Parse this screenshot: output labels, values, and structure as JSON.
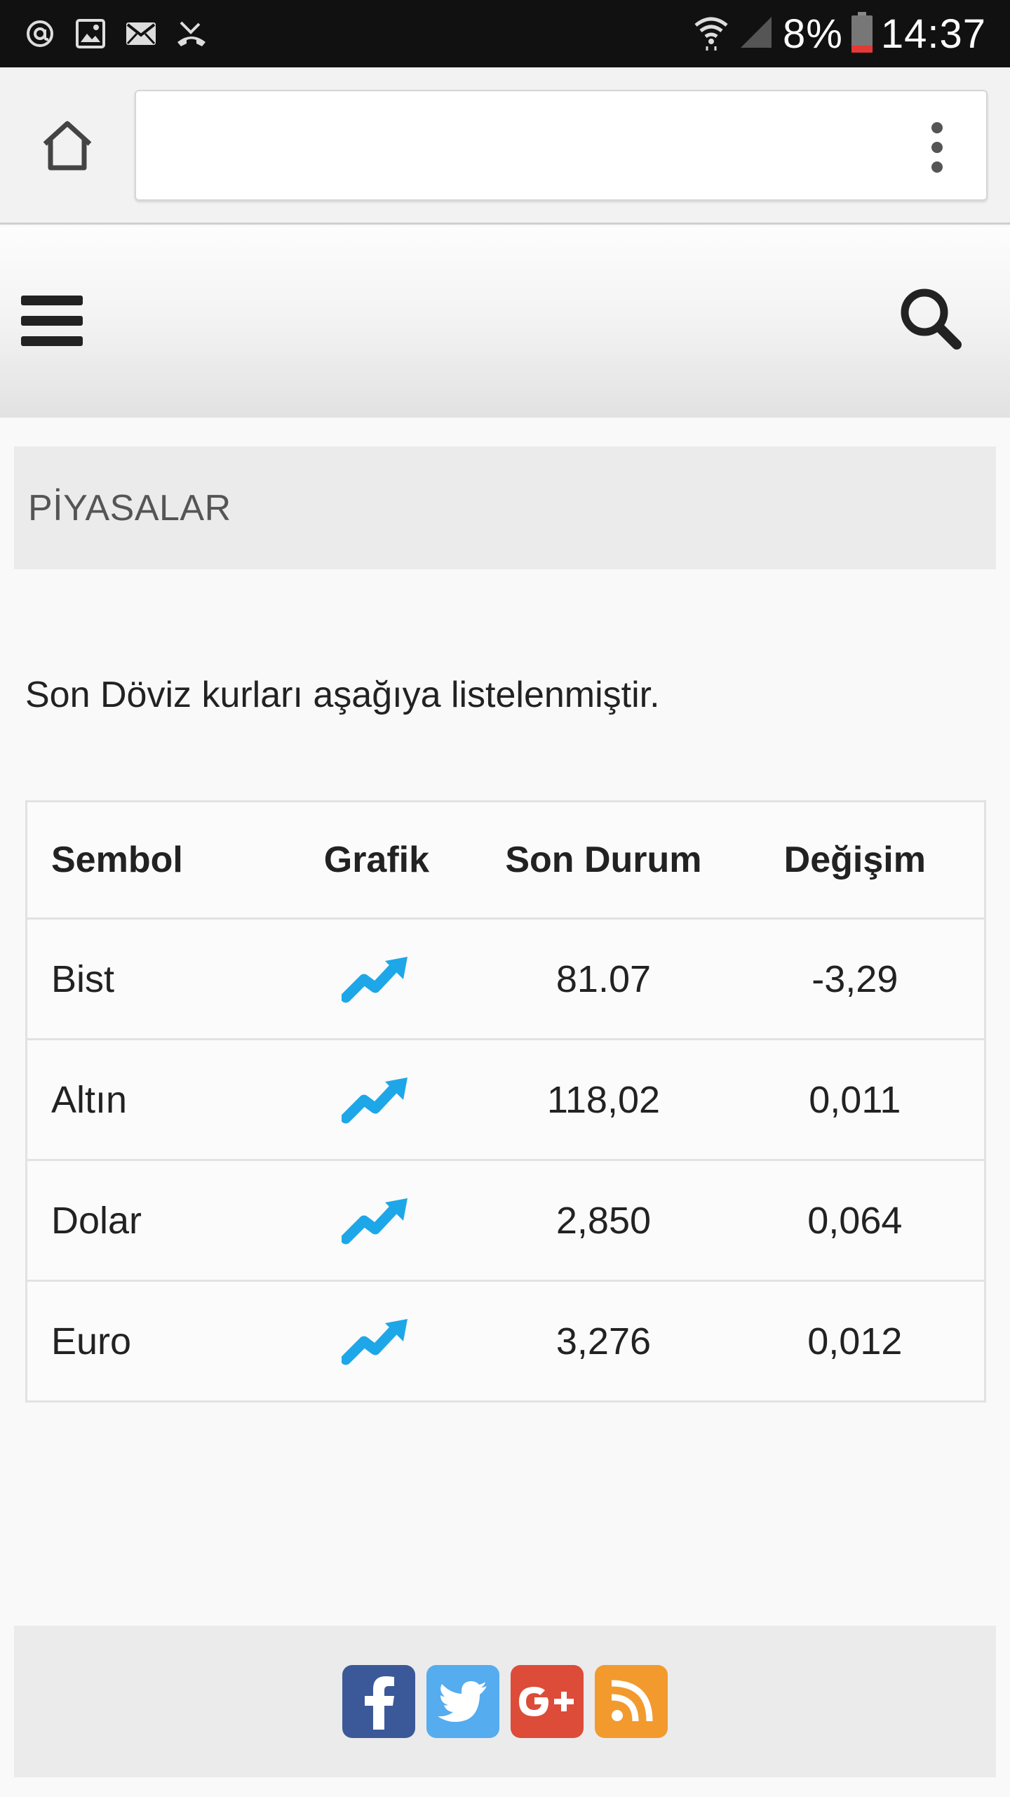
{
  "status_bar": {
    "battery_percent": "8%",
    "time": "14:37",
    "icons": [
      "at-icon",
      "image-icon",
      "mail-icon",
      "missed-call-icon",
      "wifi-icon",
      "signal-icon",
      "battery-icon"
    ]
  },
  "browser": {
    "url": "",
    "icons": [
      "home-icon",
      "more-vert-icon"
    ]
  },
  "header": {
    "icons": [
      "hamburger-menu-icon",
      "search-icon"
    ]
  },
  "section": {
    "title": "PİYASALAR",
    "intro": "Son Döviz kurları aşağıya listelenmiştir."
  },
  "table": {
    "headers": [
      "Sembol",
      "Grafik",
      "Son Durum",
      "Değişim"
    ],
    "rows": [
      {
        "symbol": "Bist",
        "graph_icon": "trend-up-icon",
        "last": "81.07",
        "change": "-3,29"
      },
      {
        "symbol": "Altın",
        "graph_icon": "trend-up-icon",
        "last": "118,02",
        "change": "0,011"
      },
      {
        "symbol": "Dolar",
        "graph_icon": "trend-up-icon",
        "last": "2,850",
        "change": "0,064"
      },
      {
        "symbol": "Euro",
        "graph_icon": "trend-up-icon",
        "last": "3,276",
        "change": "0,012"
      }
    ]
  },
  "footer": {
    "social_links": [
      "facebook-icon",
      "twitter-icon",
      "google-plus-icon",
      "rss-icon"
    ]
  },
  "colors": {
    "status_bar": "#111111",
    "trend_icon": "#1ea7e8",
    "facebook": "#3b5998",
    "twitter": "#55acee",
    "google_plus": "#dd4b39",
    "rss": "#f29a2e"
  }
}
